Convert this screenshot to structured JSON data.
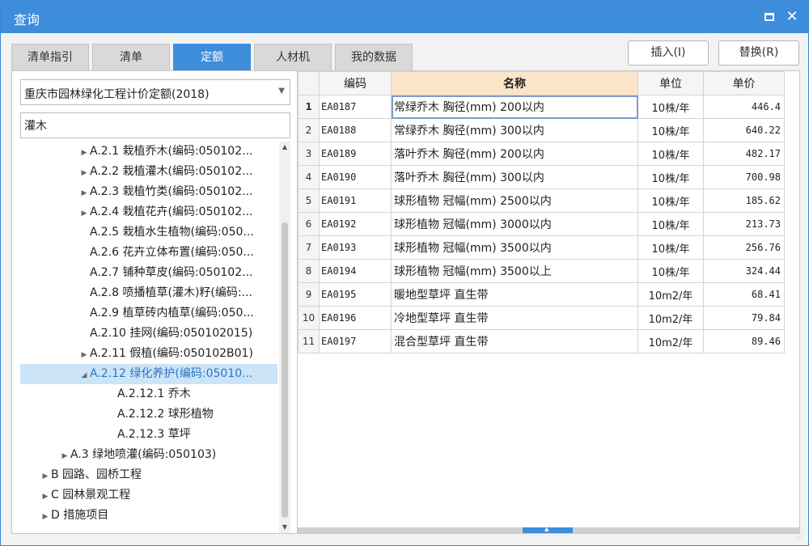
{
  "window": {
    "title": "查询",
    "maximize_icon": "maximize-icon",
    "close_label": "✕"
  },
  "tabs": [
    {
      "label": "清单指引",
      "active": false
    },
    {
      "label": "清单",
      "active": false
    },
    {
      "label": "定额",
      "active": true
    },
    {
      "label": "人材机",
      "active": false
    },
    {
      "label": "我的数据",
      "active": false
    }
  ],
  "actions": {
    "insert_label": "插入(I)",
    "replace_label": "替换(R)"
  },
  "left": {
    "quota_library": "重庆市园林绿化工程计价定额(2018)",
    "search_value": "灌木",
    "tree": [
      {
        "label": "A.2.1 栽植乔木(编码:050102...",
        "level": 3,
        "expander": "collapsed"
      },
      {
        "label": "A.2.2 栽植灌木(编码:050102...",
        "level": 3,
        "expander": "collapsed"
      },
      {
        "label": "A.2.3 栽植竹类(编码:050102...",
        "level": 3,
        "expander": "collapsed"
      },
      {
        "label": "A.2.4 栽植花卉(编码:050102...",
        "level": 3,
        "expander": "collapsed"
      },
      {
        "label": "A.2.5 栽植水生植物(编码:050...",
        "level": 3,
        "expander": "none"
      },
      {
        "label": "A.2.6 花卉立体布置(编码:050...",
        "level": 3,
        "expander": "none"
      },
      {
        "label": "A.2.7 铺种草皮(编码:050102...",
        "level": 3,
        "expander": "none"
      },
      {
        "label": "A.2.8 喷播植草(灌木)籽(编码:...",
        "level": 3,
        "expander": "none"
      },
      {
        "label": "A.2.9 植草砖内植草(编码:050...",
        "level": 3,
        "expander": "none"
      },
      {
        "label": "A.2.10 挂网(编码:050102015)",
        "level": 3,
        "expander": "none"
      },
      {
        "label": "A.2.11 假植(编码:050102B01)",
        "level": 3,
        "expander": "collapsed"
      },
      {
        "label": "A.2.12 绿化养护(编码:05010...",
        "level": 3,
        "expander": "expanded",
        "selected": true
      },
      {
        "label": "A.2.12.1 乔木",
        "level": 4,
        "expander": "none"
      },
      {
        "label": "A.2.12.2 球形植物",
        "level": 4,
        "expander": "none"
      },
      {
        "label": "A.2.12.3 草坪",
        "level": 4,
        "expander": "none"
      },
      {
        "label": "A.3 绿地喷灌(编码:050103)",
        "level": 2,
        "expander": "collapsed"
      },
      {
        "label": "B 园路、园桥工程",
        "level": 1,
        "expander": "collapsed"
      },
      {
        "label": "C 园林景观工程",
        "level": 1,
        "expander": "collapsed"
      },
      {
        "label": "D 措施项目",
        "level": 1,
        "expander": "collapsed"
      }
    ]
  },
  "grid": {
    "columns": {
      "code": "编码",
      "name": "名称",
      "unit": "单位",
      "price": "单价"
    },
    "sorted_column": "name",
    "current_row": 0,
    "rows": [
      {
        "idx": "1",
        "code": "EA0187",
        "name": "常绿乔木 胸径(mm) 200以内",
        "unit": "10株/年",
        "price": "446.4"
      },
      {
        "idx": "2",
        "code": "EA0188",
        "name": "常绿乔木 胸径(mm) 300以内",
        "unit": "10株/年",
        "price": "640.22"
      },
      {
        "idx": "3",
        "code": "EA0189",
        "name": "落叶乔木 胸径(mm) 200以内",
        "unit": "10株/年",
        "price": "482.17"
      },
      {
        "idx": "4",
        "code": "EA0190",
        "name": "落叶乔木 胸径(mm) 300以内",
        "unit": "10株/年",
        "price": "700.98"
      },
      {
        "idx": "5",
        "code": "EA0191",
        "name": "球形植物 冠幅(mm) 2500以内",
        "unit": "10株/年",
        "price": "185.62"
      },
      {
        "idx": "6",
        "code": "EA0192",
        "name": "球形植物 冠幅(mm) 3000以内",
        "unit": "10株/年",
        "price": "213.73"
      },
      {
        "idx": "7",
        "code": "EA0193",
        "name": "球形植物 冠幅(mm) 3500以内",
        "unit": "10株/年",
        "price": "256.76"
      },
      {
        "idx": "8",
        "code": "EA0194",
        "name": "球形植物 冠幅(mm) 3500以上",
        "unit": "10株/年",
        "price": "324.44"
      },
      {
        "idx": "9",
        "code": "EA0195",
        "name": "暖地型草坪 直生带",
        "unit": "10m2/年",
        "price": "68.41"
      },
      {
        "idx": "10",
        "code": "EA0196",
        "name": "冷地型草坪 直生带",
        "unit": "10m2/年",
        "price": "79.84"
      },
      {
        "idx": "11",
        "code": "EA0197",
        "name": "混合型草坪 直生带",
        "unit": "10m2/年",
        "price": "89.46"
      }
    ]
  },
  "colors": {
    "accent": "#3d8ddb",
    "selected_bg": "#cce4f7",
    "sorted_header_bg": "#fce4c8"
  }
}
